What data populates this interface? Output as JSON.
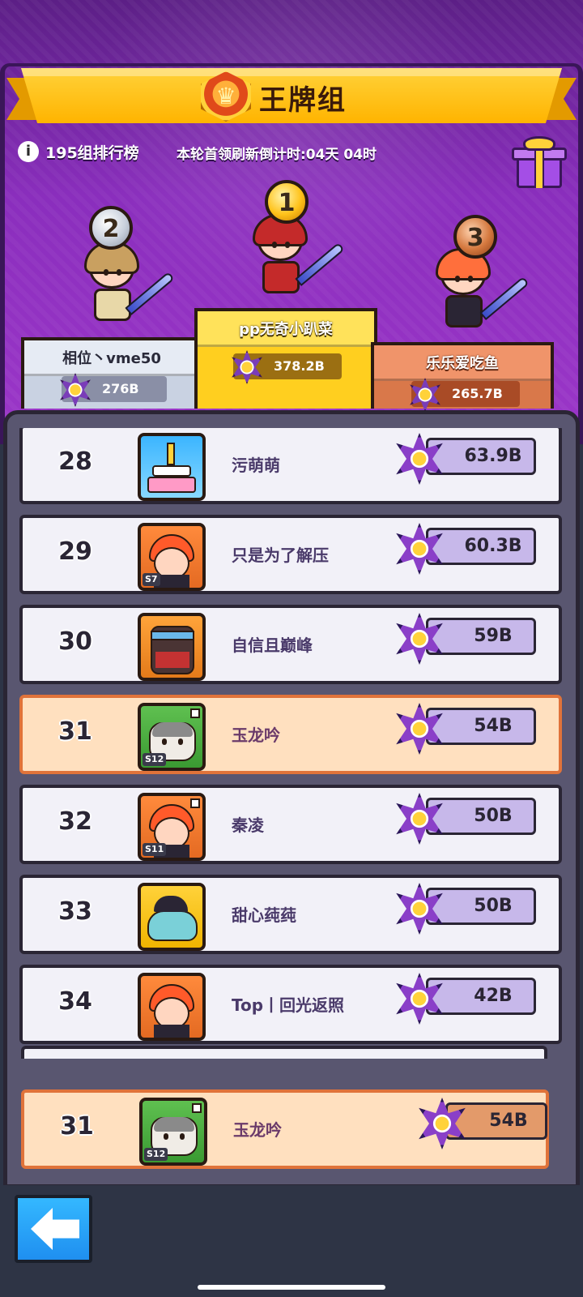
{
  "header": {
    "title": "王牌组",
    "group_info": "195组排行榜",
    "countdown": "本轮首领刷新倒计时:04天 04时",
    "info_icon": "info-icon",
    "gift_icon": "gift-icon"
  },
  "podium": {
    "first": {
      "rank": "1",
      "name": "pp无奇小趴菜",
      "score": "378.2B"
    },
    "second": {
      "rank": "2",
      "name": "相位丶vme50",
      "score": "276B"
    },
    "third": {
      "rank": "3",
      "name": "乐乐爱吃鱼",
      "score": "265.7B"
    }
  },
  "list": [
    {
      "rank": "28",
      "name": "污萌萌",
      "score": "63.9B",
      "avatar": "cake",
      "level": ""
    },
    {
      "rank": "29",
      "name": "只是为了解压",
      "score": "60.3B",
      "avatar": "hero",
      "level": "S7"
    },
    {
      "rank": "30",
      "name": "自信且巅峰",
      "score": "59B",
      "avatar": "ninja",
      "level": ""
    },
    {
      "rank": "31",
      "name": "玉龙吟",
      "score": "54B",
      "avatar": "cat",
      "level": "S12"
    },
    {
      "rank": "32",
      "name": "秦凌",
      "score": "50B",
      "avatar": "hero",
      "level": "S11"
    },
    {
      "rank": "33",
      "name": "甜心莼莼",
      "score": "50B",
      "avatar": "fish",
      "level": ""
    },
    {
      "rank": "34",
      "name": "Top丨回光返照",
      "score": "42B",
      "avatar": "hero",
      "level": ""
    }
  ],
  "self": {
    "rank": "31",
    "name": "玉龙吟",
    "score": "54B",
    "avatar": "cat",
    "level": "S12"
  },
  "colors": {
    "background_top": "#8a2ebd",
    "banner": "#ffc21a",
    "row_bg": "#f2f1f8",
    "row_highlight": "#ffe0bf",
    "score_bar": "#c7b8ea",
    "back_button": "#1f8ff0"
  },
  "footer": {
    "back_icon": "back-arrow-icon"
  }
}
